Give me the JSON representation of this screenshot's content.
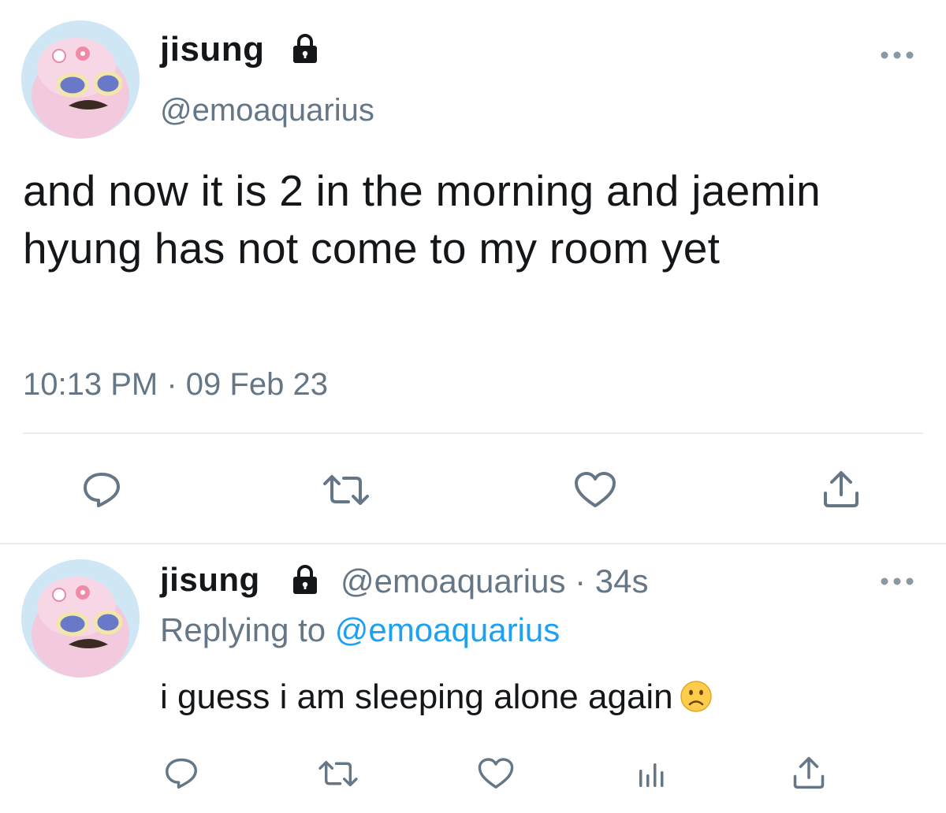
{
  "main_tweet": {
    "display_name": "jisung",
    "handle": "@emoaquarius",
    "text": "and now it is 2 in the morning and jaemin hyung has not come to my room yet",
    "time": "10:13 PM",
    "separator": "·",
    "date": "09 Feb 23",
    "icons": {
      "lock": "lock-icon",
      "more": "more-icon",
      "reply": "reply-icon",
      "retweet": "retweet-icon",
      "like": "heart-icon",
      "share": "share-icon"
    }
  },
  "reply_tweet": {
    "display_name": "jisung",
    "handle": "@emoaquarius",
    "separator": "·",
    "age": "34s",
    "replying_prefix": "Replying to",
    "replying_handle": "@emoaquarius",
    "text": "i guess i am sleeping alone again",
    "emoji": "slightly-frowning-face",
    "icons": {
      "lock": "lock-icon",
      "more": "more-icon",
      "reply": "reply-icon",
      "retweet": "retweet-icon",
      "like": "heart-icon",
      "analytics": "analytics-icon",
      "share": "share-icon"
    }
  },
  "colors": {
    "text": "#14171a",
    "secondary": "#657786",
    "link": "#1da1f2",
    "divider": "#e6ecf0"
  }
}
